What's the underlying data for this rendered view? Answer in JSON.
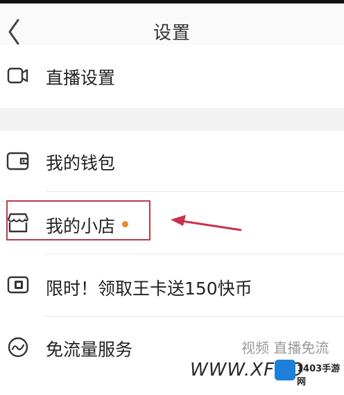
{
  "header": {
    "title": "设置"
  },
  "items": [
    {
      "label": "直播设置"
    },
    {
      "label": "我的钱包"
    },
    {
      "label": "我的小店"
    },
    {
      "label": "限时！领取王卡送150快币"
    },
    {
      "label": "免流量服务",
      "extra": "视频 直播免流"
    }
  ],
  "watermark": {
    "text": "WWW.XFDO",
    "site": "1403手游网"
  },
  "colors": {
    "highlight": "#b73a47",
    "badge_dot": "#e8892e"
  }
}
